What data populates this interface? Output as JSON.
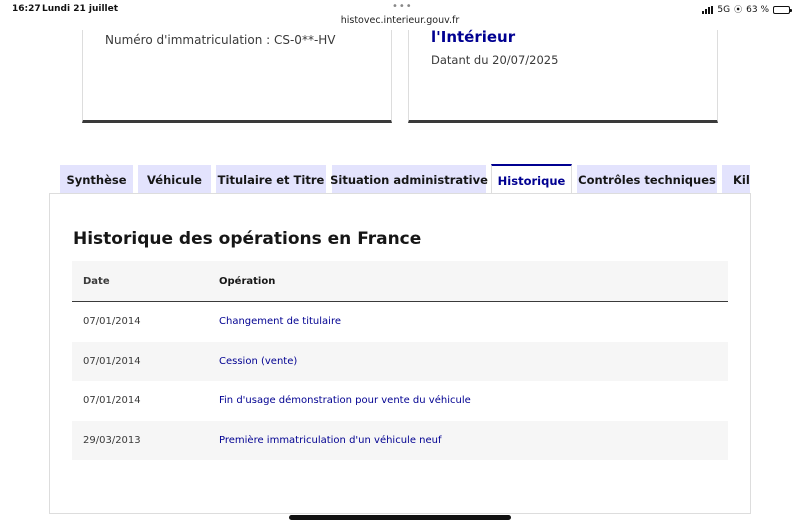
{
  "status_bar": {
    "time": "16:27",
    "date": "Lundi 21 juillet",
    "url": "histovec.interieur.gouv.fr",
    "network": "5G",
    "battery": "63 %",
    "battery_level": 0.63
  },
  "cards": {
    "left": {
      "plate": "Numéro d'immatriculation : CS-0**-HV"
    },
    "right": {
      "title": "l'Intérieur",
      "date": "Datant du 20/07/2025"
    }
  },
  "tabs": [
    {
      "label": "Synthèse",
      "active": false
    },
    {
      "label": "Véhicule",
      "active": false
    },
    {
      "label": "Titulaire et Titre",
      "active": false
    },
    {
      "label": "Situation administrative",
      "active": false
    },
    {
      "label": "Historique",
      "active": true
    },
    {
      "label": "Contrôles techniques",
      "active": false
    },
    {
      "label": "Kilo",
      "active": false
    }
  ],
  "history": {
    "title": "Historique des opérations en France",
    "columns": {
      "date": "Date",
      "operation": "Opération"
    },
    "rows": [
      {
        "date": "07/01/2014",
        "operation": "Changement de titulaire"
      },
      {
        "date": "07/01/2014",
        "operation": "Cession (vente)"
      },
      {
        "date": "07/01/2014",
        "operation": "Fin d'usage démonstration pour vente du véhicule"
      },
      {
        "date": "29/03/2013",
        "operation": "Première immatriculation d'un véhicule neuf"
      }
    ]
  },
  "colors": {
    "accent": "#000091",
    "tab_background": "#e3e3fd",
    "row_alt": "#f6f6f6",
    "card_border": "#3a3a3a"
  }
}
